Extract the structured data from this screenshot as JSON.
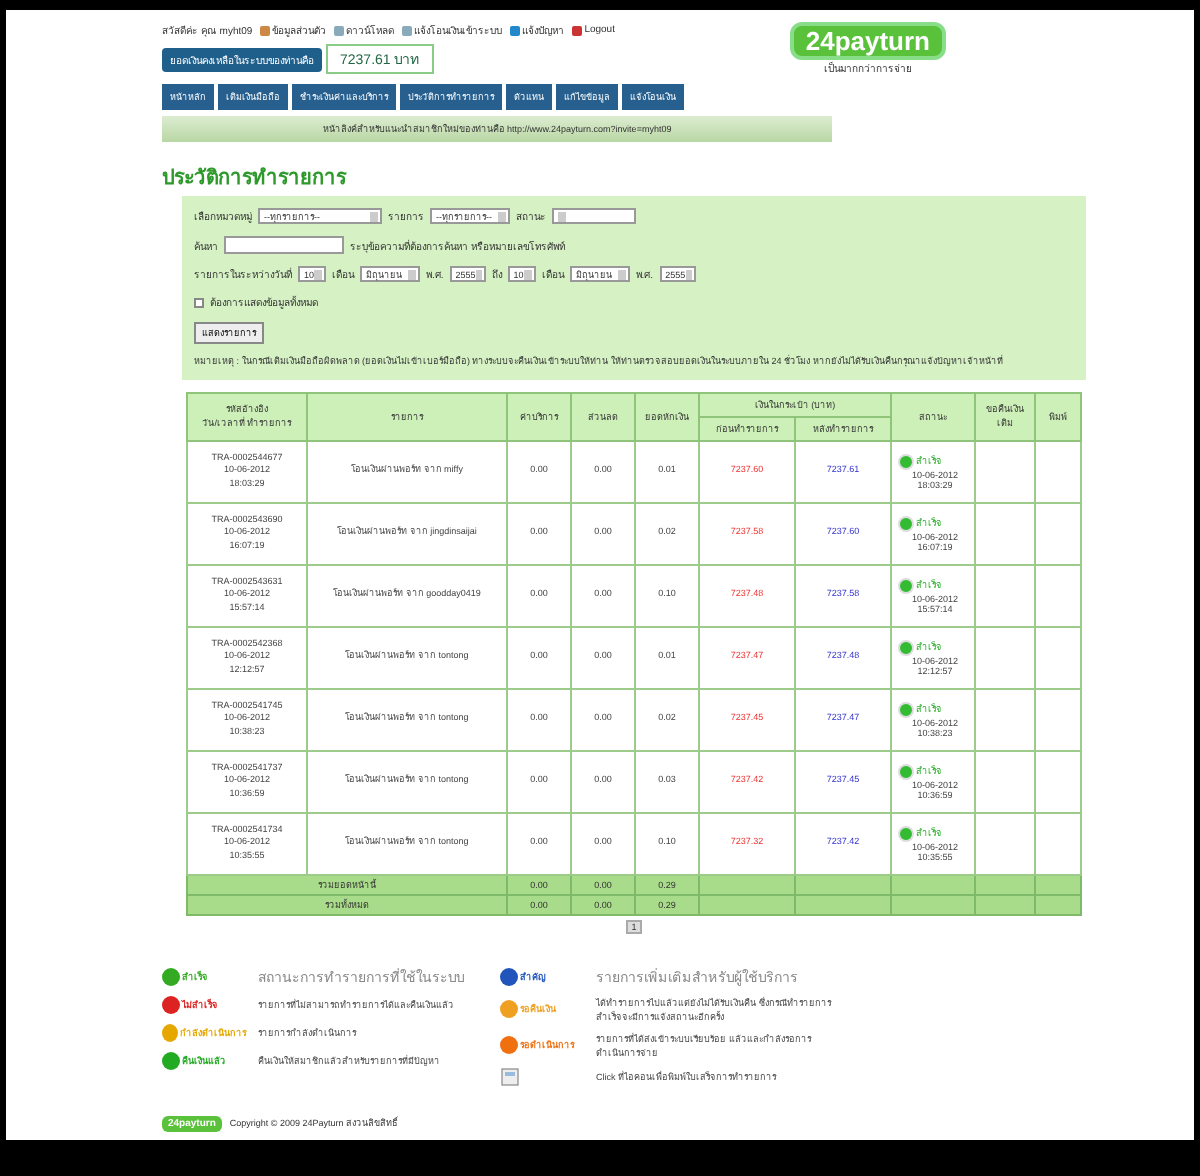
{
  "header": {
    "greeting": "สวัสดีค่ะ คุณ myht09",
    "links": [
      {
        "kind": "user",
        "label": "ข้อมูลส่วนตัว"
      },
      {
        "kind": "doc",
        "label": "ดาวน์โหลด"
      },
      {
        "kind": "doc",
        "label": "แจ้งโอนเงินเข้าระบบ"
      },
      {
        "kind": "help",
        "label": "แจ้งปัญหา"
      },
      {
        "kind": "logout",
        "label": "Logout"
      }
    ],
    "balance_label": "ยอดเงินคงเหลือในระบบของท่านคือ",
    "balance": "7237.61 บาท",
    "nav": [
      "หน้าหลัก",
      "เติมเงินมือถือ",
      "ชำระเงินค่าและบริการ",
      "ประวัติการทำรายการ",
      "ตัวแทน",
      "แก้ไขข้อมูล",
      "แจ้งโอนเงิน"
    ],
    "logo": "24payturn",
    "slogan": "เป็นมากกว่าการจ่าย",
    "invite": "หน้าลิงค์สำหรับแนะนำสมาชิกใหม่ของท่านคือ http://www.24payturn.com?invite=myht09"
  },
  "title": "ประวัติการทำรายการ",
  "filters": {
    "category_label": "เลือกหมวดหมู่",
    "category": "--ทุกรายการ--",
    "item_label": "รายการ",
    "item": "--ทุกรายการ--",
    "status_label": "สถานะ",
    "search_label": "ค้นหา",
    "search_hint": "ระบุข้อความที่ต้องการค้นหา หรือหมายเลขโทรศัพท์",
    "range_label": "รายการในระหว่างวันที่",
    "to_label": "ถึง",
    "from": {
      "day": "10",
      "month_label": "เดือน",
      "month": "มิถุนายน",
      "year_label": "พ.ศ.",
      "year": "2555"
    },
    "to": {
      "day": "10",
      "month_label": "เดือน",
      "month": "มิถุนายน",
      "year_label": "พ.ศ.",
      "year": "2555"
    },
    "show_all": {
      "label": "ต้องการแสดงข้อมูลทั้งหมด",
      "checked": false
    },
    "submit": "แสดงรายการ"
  },
  "note": "หมายเหตุ : ในกรณีเติมเงินมือถือผิดพลาด (ยอดเงินไม่เข้าเบอร์มือถือ) ทางระบบจะคืนเงินเข้าระบบให้ท่าน ให้ท่านตรวจสอบยอดเงินในระบบภายใน 24 ชั่วโมง หากยังไม่ได้รับเงินคืนกรุณาแจ้งปัญหาเจ้าหน้าที่",
  "table": {
    "columns": [
      "รหัสอ้างอิง\nวัน/เวลาที่ ทำรายการ",
      "รายการ",
      "ค่าบริการ",
      "ส่วนลด",
      "ยอดหักเงิน",
      "เงินในกระเป๋า (บาท)",
      "สถานะ",
      "ขอคืนเงินเติม",
      "พิมพ์"
    ],
    "subcolumns": [
      "ก่อนทำรายการ",
      "หลังทำรายการ"
    ],
    "rows": [
      {
        "ref": "TRA-0002544677",
        "date": "10-06-2012",
        "time": "18:03:29",
        "item": "โอนเงินผ่านพอร์ท จาก miffy",
        "fee": "0.00",
        "discount": "0.00",
        "total": "0.01",
        "before": "7237.60",
        "after": "7237.61",
        "status": {
          "kind": "success",
          "label": "สำเร็จ",
          "date": "10-06-2012",
          "time": "18:03:29"
        }
      },
      {
        "ref": "TRA-0002543690",
        "date": "10-06-2012",
        "time": "16:07:19",
        "item": "โอนเงินผ่านพอร์ท จาก jingdinsaijai",
        "fee": "0.00",
        "discount": "0.00",
        "total": "0.02",
        "before": "7237.58",
        "after": "7237.60",
        "status": {
          "kind": "success",
          "label": "สำเร็จ",
          "date": "10-06-2012",
          "time": "16:07:19"
        }
      },
      {
        "ref": "TRA-0002543631",
        "date": "10-06-2012",
        "time": "15:57:14",
        "item": "โอนเงินผ่านพอร์ท จาก goodday0419",
        "fee": "0.00",
        "discount": "0.00",
        "total": "0.10",
        "before": "7237.48",
        "after": "7237.58",
        "status": {
          "kind": "success",
          "label": "สำเร็จ",
          "date": "10-06-2012",
          "time": "15:57:14"
        }
      },
      {
        "ref": "TRA-0002542368",
        "date": "10-06-2012",
        "time": "12:12:57",
        "item": "โอนเงินผ่านพอร์ท จาก tontong",
        "fee": "0.00",
        "discount": "0.00",
        "total": "0.01",
        "before": "7237.47",
        "after": "7237.48",
        "status": {
          "kind": "success",
          "label": "สำเร็จ",
          "date": "10-06-2012",
          "time": "12:12:57"
        }
      },
      {
        "ref": "TRA-0002541745",
        "date": "10-06-2012",
        "time": "10:38:23",
        "item": "โอนเงินผ่านพอร์ท จาก tontong",
        "fee": "0.00",
        "discount": "0.00",
        "total": "0.02",
        "before": "7237.45",
        "after": "7237.47",
        "status": {
          "kind": "success",
          "label": "สำเร็จ",
          "date": "10-06-2012",
          "time": "10:38:23"
        }
      },
      {
        "ref": "TRA-0002541737",
        "date": "10-06-2012",
        "time": "10:36:59",
        "item": "โอนเงินผ่านพอร์ท จาก tontong",
        "fee": "0.00",
        "discount": "0.00",
        "total": "0.03",
        "before": "7237.42",
        "after": "7237.45",
        "status": {
          "kind": "success",
          "label": "สำเร็จ",
          "date": "10-06-2012",
          "time": "10:36:59"
        }
      },
      {
        "ref": "TRA-0002541734",
        "date": "10-06-2012",
        "time": "10:35:55",
        "item": "โอนเงินผ่านพอร์ท จาก tontong",
        "fee": "0.00",
        "discount": "0.00",
        "total": "0.10",
        "before": "7237.32",
        "after": "7237.42",
        "status": {
          "kind": "success",
          "label": "สำเร็จ",
          "date": "10-06-2012",
          "time": "10:35:55"
        }
      }
    ],
    "totals": [
      {
        "label": "รวมยอดหน้านี้",
        "fee": "0.00",
        "discount": "0.00",
        "total": "0.29"
      },
      {
        "label": "รวมทั้งหมด",
        "fee": "0.00",
        "discount": "0.00",
        "total": "0.29"
      }
    ],
    "pages": [
      {
        "label": "1",
        "selected": true
      }
    ]
  },
  "legend": {
    "left": [
      {
        "kind": "heading",
        "badge": "สำเร็จ",
        "color": "#33aa22",
        "text": "สถานะการทำรายการที่ใช้ในระบบ"
      },
      {
        "kind": "item",
        "badge": "ไม่สำเร็จ",
        "color": "#dd2222",
        "text": "รายการที่ไม่สามารถทำรายการได้และคืนเงินแล้ว"
      },
      {
        "kind": "item",
        "badge": "กำลังดำเนินการ",
        "color": "#e6a800",
        "text": "รายการกำลังดำเนินการ"
      },
      {
        "kind": "item",
        "badge": "คืนเงินแล้ว",
        "color": "#22aa22",
        "text": "คืนเงินให้สมาชิกแล้วสำหรับรายการที่มีปัญหา"
      }
    ],
    "right": [
      {
        "kind": "heading",
        "badge": "สำคัญ",
        "color": "#2255bb",
        "text": "รายการเพิ่มเติมสำหรับผู้ใช้บริการ"
      },
      {
        "kind": "item",
        "badge": "รอคืนเงิน",
        "color": "#f0a020",
        "text": "ได้ทำรายการไปแล้วแต่ยังไม่ได้รับเงินคืน ซึ่งกรณีทำรายการสำเร็จจะมีการแจ้งสถานะอีกครั้ง"
      },
      {
        "kind": "item",
        "badge": "รอดำเนินการ",
        "color": "#f07010",
        "text": "รายการที่ได้ส่งเข้าระบบเรียบร้อย แล้วและกำลังรอการดำเนินการจ่าย"
      },
      {
        "kind": "print",
        "text": "Click ที่ไอคอนเพื่อพิมพ์ใบเสร็จการทำรายการ"
      }
    ]
  },
  "footer": {
    "logo": "24payturn",
    "copyright": "Copyright © 2009 24Payturn สงวนลิขสิทธิ์"
  }
}
